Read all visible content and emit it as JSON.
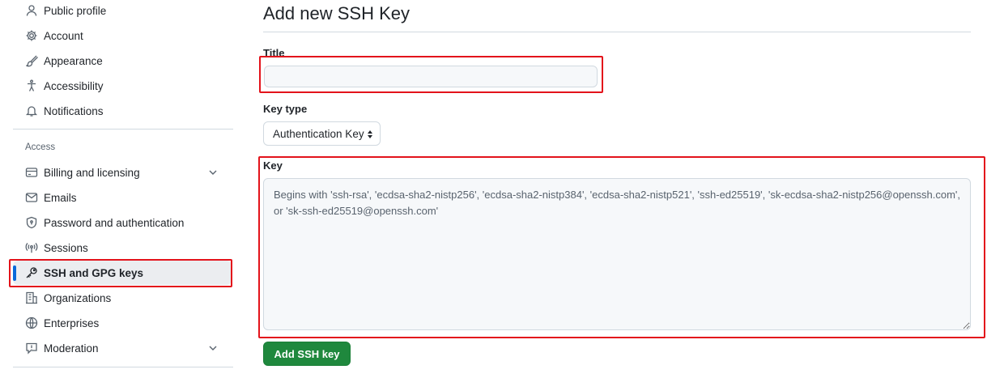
{
  "sidebar": {
    "top_items": [
      {
        "label": "Public profile",
        "icon": "person-icon"
      },
      {
        "label": "Account",
        "icon": "gear-icon"
      },
      {
        "label": "Appearance",
        "icon": "paintbrush-icon"
      },
      {
        "label": "Accessibility",
        "icon": "accessibility-icon"
      },
      {
        "label": "Notifications",
        "icon": "bell-icon"
      }
    ],
    "section_label": "Access",
    "access_items": [
      {
        "label": "Billing and licensing",
        "icon": "credit-card-icon",
        "expandable": true
      },
      {
        "label": "Emails",
        "icon": "mail-icon"
      },
      {
        "label": "Password and authentication",
        "icon": "shield-lock-icon"
      },
      {
        "label": "Sessions",
        "icon": "broadcast-icon"
      },
      {
        "label": "SSH and GPG keys",
        "icon": "key-icon",
        "active": true
      },
      {
        "label": "Organizations",
        "icon": "organization-icon"
      },
      {
        "label": "Enterprises",
        "icon": "globe-icon"
      },
      {
        "label": "Moderation",
        "icon": "report-icon",
        "expandable": true
      }
    ]
  },
  "main": {
    "heading": "Add new SSH Key",
    "title_label": "Title",
    "title_value": "",
    "key_type_label": "Key type",
    "key_type_selected": "Authentication Key",
    "key_label": "Key",
    "key_placeholder": "Begins with 'ssh-rsa', 'ecdsa-sha2-nistp256', 'ecdsa-sha2-nistp384', 'ecdsa-sha2-nistp521', 'ssh-ed25519', 'sk-ecdsa-sha2-nistp256@openssh.com', or 'sk-ssh-ed25519@openssh.com'",
    "submit_label": "Add SSH key"
  },
  "colors": {
    "accent": "#0969da",
    "primary_button": "#1f883d",
    "annotation": "#e3131b"
  }
}
